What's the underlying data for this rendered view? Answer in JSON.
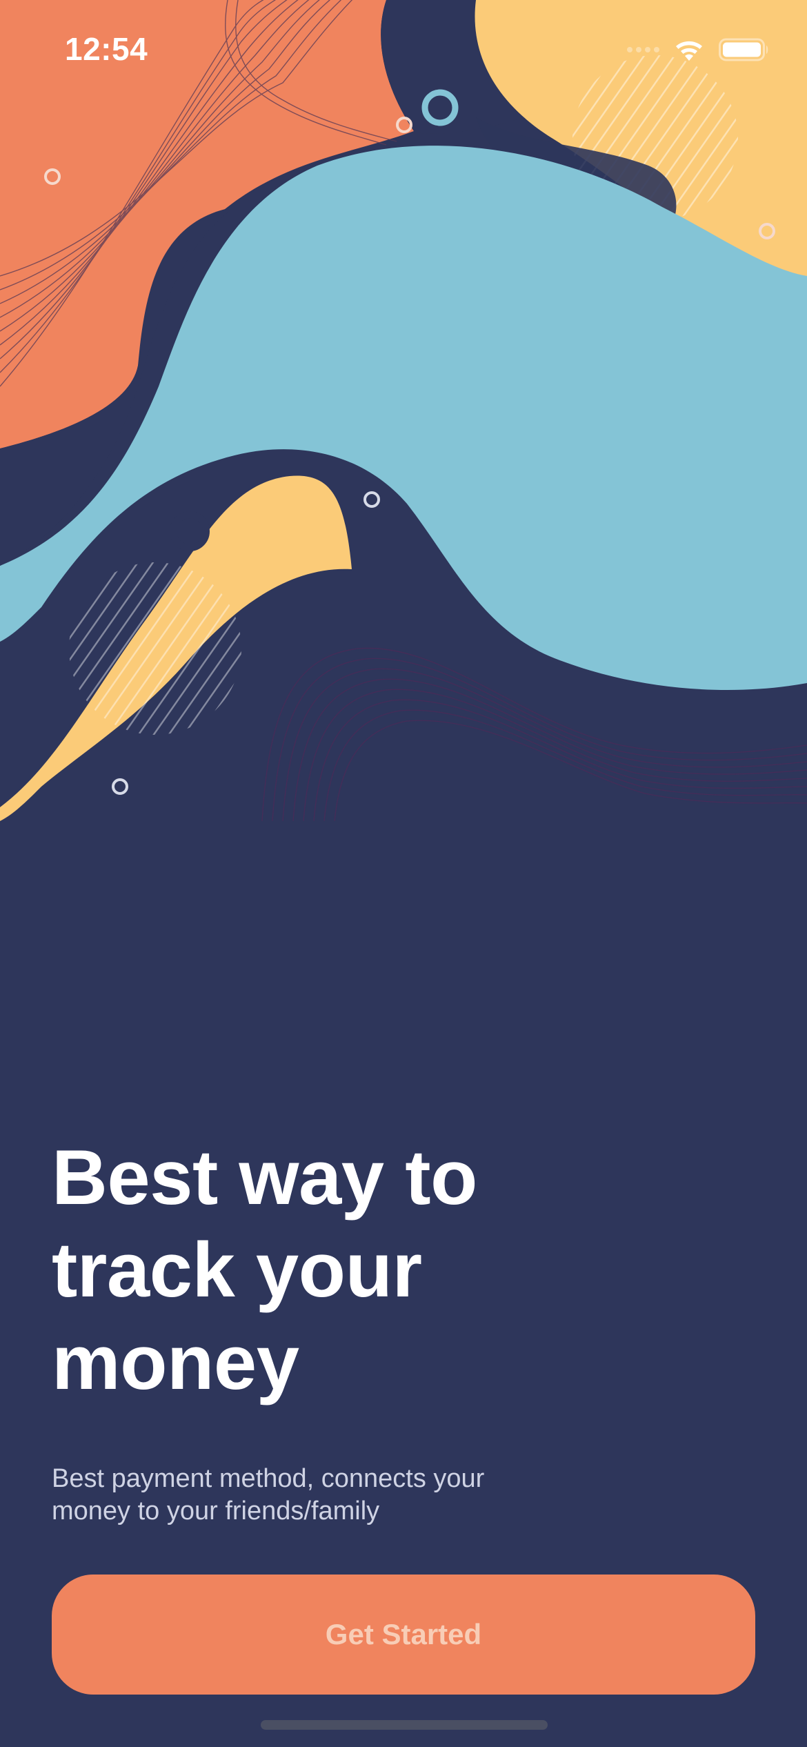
{
  "status_bar": {
    "time": "12:54",
    "wifi_icon": "wifi-icon",
    "battery_icon": "battery-icon"
  },
  "hero": {
    "illustration": "abstract-wave-illustration",
    "colors": {
      "background": "#2e365b",
      "orange": "#f0845e",
      "yellow": "#fbcb78",
      "blue": "#84c4d6",
      "navy": "#2e365b"
    }
  },
  "onboarding": {
    "headline": "Best way to track your money",
    "subtitle": "Best payment method, connects your money to your friends/family",
    "cta_label": "Get Started"
  }
}
